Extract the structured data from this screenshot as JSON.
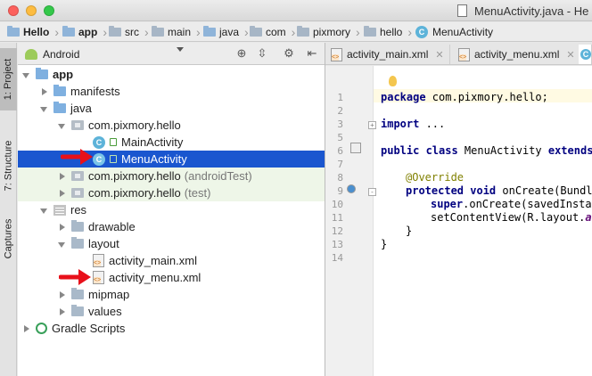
{
  "window": {
    "title": "MenuActivity.java - He"
  },
  "breadcrumb": [
    {
      "label": "Hello",
      "icon": "module-folder-icon"
    },
    {
      "label": "app",
      "icon": "module-folder-icon"
    },
    {
      "label": "src",
      "icon": "folder-icon"
    },
    {
      "label": "main",
      "icon": "folder-icon"
    },
    {
      "label": "java",
      "icon": "folder-icon"
    },
    {
      "label": "com",
      "icon": "folder-icon"
    },
    {
      "label": "pixmory",
      "icon": "folder-icon"
    },
    {
      "label": "hello",
      "icon": "folder-icon"
    },
    {
      "label": "MenuActivity",
      "icon": "class-icon"
    }
  ],
  "side_tabs": [
    {
      "label": "1: Project",
      "active": true
    },
    {
      "label": "7: Structure",
      "active": false
    },
    {
      "label": "Captures",
      "active": false
    }
  ],
  "project_panel": {
    "view": "Android",
    "tree": [
      {
        "label": "app",
        "bold": true,
        "expanded": true,
        "icon": "module-icon"
      },
      {
        "label": "manifests",
        "expanded": false,
        "icon": "folder-icon"
      },
      {
        "label": "java",
        "expanded": true,
        "icon": "folder-icon"
      },
      {
        "label": "com.pixmory.hello",
        "expanded": true,
        "icon": "package-icon"
      },
      {
        "label": "MainActivity",
        "icon": "class-icon"
      },
      {
        "label": "MenuActivity",
        "icon": "class-icon",
        "selected": true
      },
      {
        "label": "com.pixmory.hello",
        "suffix": "(androidTest)",
        "expanded": false,
        "icon": "package-icon"
      },
      {
        "label": "com.pixmory.hello",
        "suffix": "(test)",
        "expanded": false,
        "icon": "package-icon"
      },
      {
        "label": "res",
        "expanded": true,
        "icon": "res-folder-icon"
      },
      {
        "label": "drawable",
        "expanded": false,
        "icon": "folder-icon"
      },
      {
        "label": "layout",
        "expanded": true,
        "icon": "folder-icon"
      },
      {
        "label": "activity_main.xml",
        "icon": "xml-file-icon"
      },
      {
        "label": "activity_menu.xml",
        "icon": "xml-file-icon"
      },
      {
        "label": "mipmap",
        "expanded": false,
        "icon": "folder-icon"
      },
      {
        "label": "values",
        "expanded": false,
        "icon": "folder-icon"
      },
      {
        "label": "Gradle Scripts",
        "expanded": false,
        "icon": "gradle-icon"
      }
    ]
  },
  "editor": {
    "tabs": [
      {
        "label": "activity_main.xml",
        "active": false
      },
      {
        "label": "activity_menu.xml",
        "active": false
      }
    ],
    "line_numbers": [
      "1",
      "2",
      "3",
      "5",
      "6",
      "7",
      "8",
      "9",
      "10",
      "11",
      "12",
      "13",
      "14"
    ],
    "code": {
      "l1_kw": "package",
      "l1_rest": " com.pixmory.hello;",
      "l3_kw": "import",
      "l3_rest": " ...",
      "l6_kw": "public class",
      "l6_rest": " MenuActivity ",
      "l6_kw2": "extends",
      "l8_anno": "@Override",
      "l9_kw": "protected void",
      "l9_rest": " onCreate(Bundle",
      "l10_kw": "super",
      "l10_rest": ".onCreate(savedInstan",
      "l11_rest": "setContentView(R.layout.",
      "l11_field": "ac",
      "l12": "}",
      "l13": "}"
    }
  },
  "colors": {
    "selection": "#1a56cf",
    "keyword": "#000080",
    "annotation": "#808000",
    "arrow": "#e8101a"
  }
}
